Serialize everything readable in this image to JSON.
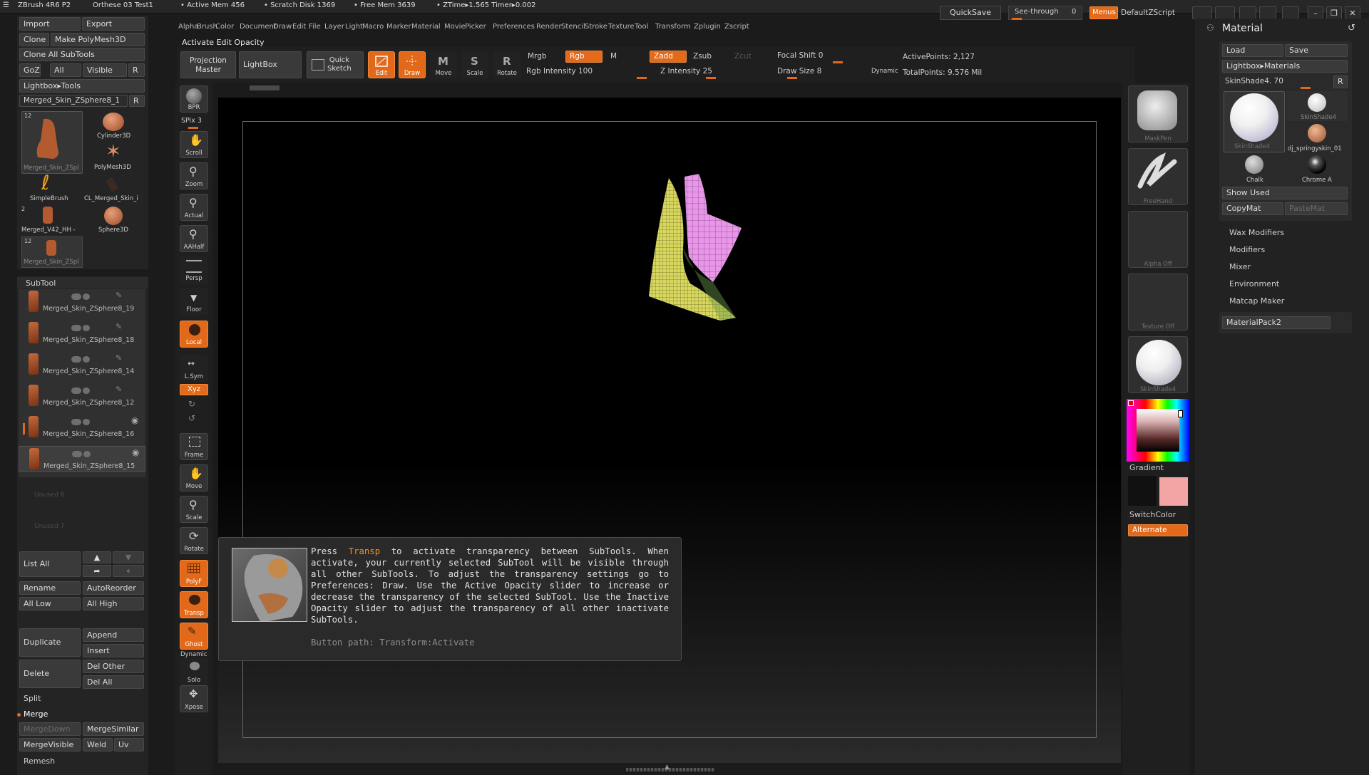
{
  "titlebar": {
    "app": "ZBrush 4R6 P2",
    "doc": "Orthese 03 Test1",
    "active_mem": "• Active Mem 456",
    "scratch_disk": "• Scratch Disk 1369",
    "free_mem": "• Free Mem 3639",
    "ztime": "• ZTime▸1.565 Timer▸0.002",
    "quicksave": "QuickSave",
    "see_through": "See-through",
    "see_through_value": "0",
    "menus": "Menus",
    "default_zscript": "DefaultZScript"
  },
  "menubar": [
    "Alpha",
    "Brush",
    "Color",
    "Document",
    "Draw",
    "Edit",
    "File",
    "Layer",
    "Light",
    "Macro",
    "Marker",
    "Material",
    "Movie",
    "Picker",
    "Preferences",
    "Render",
    "Stencil",
    "Stroke",
    "Texture",
    "Tool",
    "Transform",
    "Zplugin",
    "Zscript"
  ],
  "status_line": "Activate Edit Opacity",
  "left_tool": {
    "import": "Import",
    "export": "Export",
    "clone": "Clone",
    "make_polymesh": "Make PolyMesh3D",
    "clone_all": "Clone All SubTools",
    "goz": "GoZ",
    "all": "All",
    "visible": "Visible",
    "r": "R",
    "lightbox_tools": "Lightbox▸Tools",
    "current_tool": "Merged_Skin_ZSphere8_1",
    "tools": [
      {
        "name": "Merged_Skin_ZSpl",
        "badge": "12"
      },
      {
        "name": "Cylinder3D",
        "badge": ""
      },
      {
        "name": "PolyMesh3D",
        "badge": ""
      },
      {
        "name": "SimpleBrush",
        "badge": ""
      },
      {
        "name": "CL_Merged_Skin_i",
        "badge": ""
      },
      {
        "name": "Merged_V42_HH -",
        "badge": "2"
      },
      {
        "name": "Sphere3D",
        "badge": ""
      },
      {
        "name": "Merged_Skin_ZSpl",
        "badge": "12"
      }
    ],
    "subtool_header": "SubTool",
    "subtools": [
      "Merged_Skin_ZSphere8_19",
      "Merged_Skin_ZSphere8_18",
      "Merged_Skin_ZSphere8_14",
      "Merged_Skin_ZSphere8_12",
      "Merged_Skin_ZSphere8_16",
      "Merged_Skin_ZSphere8_15"
    ],
    "unused": [
      "Unused 6",
      "Unused 7"
    ],
    "list_all": "List All",
    "rename": "Rename",
    "autoreorder": "AutoReorder",
    "all_low": "All Low",
    "all_high": "All High",
    "duplicate": "Duplicate",
    "append": "Append",
    "insert": "Insert",
    "delete": "Delete",
    "del_other": "Del Other",
    "del_all": "Del All",
    "split": "Split",
    "merge": "Merge",
    "mergedown": "MergeDown",
    "mergesimilar": "MergeSimilar",
    "mergevisible": "MergeVisible",
    "weld": "Weld",
    "uv": "Uv",
    "remesh": "Remesh"
  },
  "top_shelf": {
    "projection_master": "Projection\nMaster",
    "lightbox": "LightBox",
    "quick_sketch": "Quick\nSketch",
    "edit": "Edit",
    "draw": "Draw",
    "move": "Move",
    "scale": "Scale",
    "rotate": "Rotate",
    "mrgb": "Mrgb",
    "rgb": "Rgb",
    "m": "M",
    "rgb_intensity": "Rgb Intensity 100",
    "zadd": "Zadd",
    "zsub": "Zsub",
    "zcut": "Zcut",
    "z_intensity": "Z Intensity 25",
    "focal_shift": "Focal Shift 0",
    "draw_size": "Draw Size 8",
    "dynamic": "Dynamic",
    "active_points": "ActivePoints: 2,127",
    "total_points": "TotalPoints: 9.576 Mil"
  },
  "left_strip": [
    {
      "cap": "BPR"
    },
    {
      "cap": "SPix 3"
    },
    {
      "cap": "Scroll"
    },
    {
      "cap": "Zoom"
    },
    {
      "cap": "Actual"
    },
    {
      "cap": "AAHalf"
    },
    {
      "cap": "Persp"
    },
    {
      "cap": "Floor"
    },
    {
      "cap": "Local"
    },
    {
      "cap": "L.Sym"
    },
    {
      "cap": "Xyz"
    },
    {
      "cap": "Frame"
    },
    {
      "cap": "Move"
    },
    {
      "cap": "Scale"
    },
    {
      "cap": "Rotate"
    },
    {
      "cap": "PolyF"
    },
    {
      "cap": "Transp"
    },
    {
      "cap": "Ghost"
    },
    {
      "cap": "Dynamic"
    },
    {
      "cap": "Solo"
    },
    {
      "cap": "Xpose"
    }
  ],
  "tooltip": {
    "press": "Press",
    "keyword": "Transp",
    "body": "to activate transparency between SubTools.  When activate, your currently selected SubTool will be visible through all other SubTools.  To adjust the transparency settings go to Preferences: Draw.  Use the Active Opacity slider to increase or decrease the transparency of the selected SubTool.  Use the Inactive Opacity slider to adjust the transparency of all other inactivate SubTools.",
    "path": "Button path: Transform:Activate"
  },
  "right_tray": {
    "maskpen": "MaskPen",
    "freehand": "FreeHand",
    "alpha_off": "Alpha  Off",
    "texture_off": "Texture  Off",
    "skinshade": "SkinShade4",
    "gradient": "Gradient",
    "switchcolor": "SwitchColor",
    "alternate": "Alternate",
    "primary_color": "#111111",
    "secondary_color": "#f3a4a4"
  },
  "material": {
    "title": "Material",
    "load": "Load",
    "save": "Save",
    "lightbox_materials": "Lightbox▸Materials",
    "current": "SkinShade4. 70",
    "r": "R",
    "items": [
      "SkinShade4",
      "SkinShade4",
      "dj_springyskin_01",
      "Chalk",
      "Chrome A"
    ],
    "show_used": "Show Used",
    "copymat": "CopyMat",
    "pastemat": "PasteMat",
    "sections": [
      "Wax Modifiers",
      "Modifiers",
      "Mixer",
      "Environment",
      "Matcap Maker"
    ],
    "materialpack": "MaterialPack2"
  },
  "colors": {
    "accent": "#e2691a",
    "panel": "#242424",
    "bg": "#1b1b1b"
  }
}
